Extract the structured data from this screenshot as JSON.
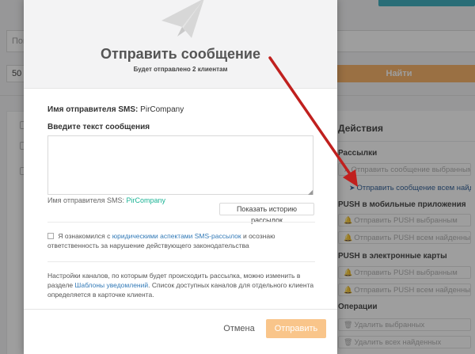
{
  "background": {
    "search_placeholder": "Пои",
    "page_size": "50",
    "find_button": "Найти",
    "actions": {
      "title": "Действия",
      "sections": [
        {
          "label": "Рассылки",
          "buttons": [
            {
              "label": "Отправить сообщение выбранным",
              "active": false,
              "icon": "paper-plane-icon"
            },
            {
              "label": "Отправить сообщение всем найденным",
              "active": true,
              "icon": "paper-plane-icon"
            }
          ]
        },
        {
          "label": "PUSH в мобильные приложения",
          "buttons": [
            {
              "label": "Отправить PUSH выбранным",
              "active": false,
              "icon": "bell-icon"
            },
            {
              "label": "Отправить PUSH всем найденным",
              "active": false,
              "icon": "bell-icon"
            }
          ]
        },
        {
          "label": "PUSH в электронные карты",
          "buttons": [
            {
              "label": "Отправить PUSH выбранным",
              "active": false,
              "icon": "bell-icon"
            },
            {
              "label": "Отправить PUSH всем найденным",
              "active": false,
              "icon": "bell-icon"
            }
          ]
        },
        {
          "label": "Операции",
          "buttons": [
            {
              "label": "Удалить выбранных",
              "active": false,
              "icon": "trash-icon"
            },
            {
              "label": "Удалить всех найденных",
              "active": false,
              "icon": "trash-icon"
            }
          ]
        }
      ]
    }
  },
  "modal": {
    "icon": "paper-plane-icon",
    "title": "Отправить сообщение",
    "subtitle": "Будет отправлено 2 клиентам",
    "sender_label": "Имя отправителя SMS:",
    "sender_value": "PirCompany",
    "message_label": "Введите текст сообщения",
    "message_value": "",
    "hint_prefix": "Имя отправителя SMS:",
    "hint_link": "PirCompany",
    "history_button": "Показать историю рассылок",
    "agree_prefix": "Я ознакомился с",
    "agree_link": "юридическими аспектами SMS-рассылок",
    "agree_suffix": "и осознаю ответственность за нарушение действующего законодательства",
    "note_prefix": "Настройки каналов, по которым будет происходить рассылка, можно изменить в разделе",
    "note_link": "Шаблоны уведомлений",
    "note_suffix": ". Список доступных каналов для отдельного клиента определяется в карточке клиента.",
    "cancel_button": "Отмена",
    "send_button": "Отправить"
  },
  "annotation": {
    "arrow_color": "#c0201e"
  }
}
